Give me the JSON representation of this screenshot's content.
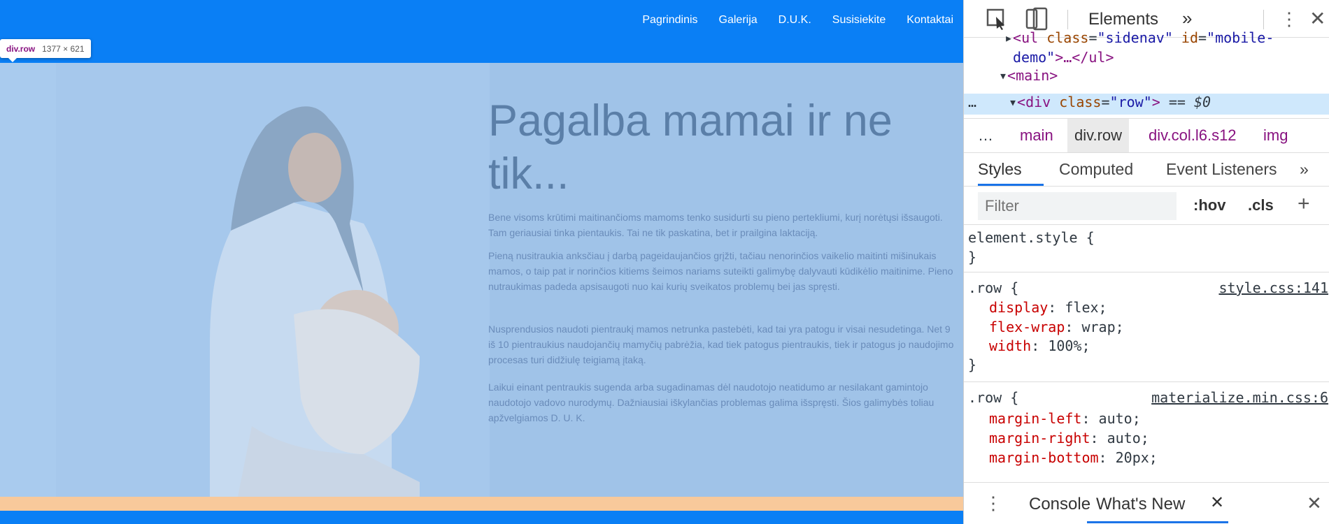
{
  "site": {
    "nav": [
      "Pagrindinis",
      "Galerija",
      "D.U.K.",
      "Susisiekite",
      "Kontaktai"
    ],
    "hero_title": "Pagalba mamai ir ne\ntik...",
    "paragraphs": [
      "Bene visoms krūtimi maitinančioms mamoms tenko susidurti su pieno pertekliumi, kurį norėtųsi išsaugoti. Tam geriausiai tinka pientaukis. Tai ne tik paskatina, bet ir prailgina laktaciją.",
      "Pieną nusitraukia anksčiau į darbą pageidaujančios grįžti, tačiau nenorinčios vaikelio maitinti mišinukais mamos, o taip pat ir norinčios kitiems šeimos nariams suteikti galimybę dalyvauti kūdikėlio maitinime. Pieno nutraukimas padeda apsisaugoti nuo kai kurių sveikatos problemų bei jas spręsti.",
      "Nusprendusios naudoti pientraukį mamos netrunka pastebėti, kad tai yra patogu ir visai nesudetinga. Net 9 iš 10 pientraukius naudojančių mamyčių pabrėžia, kad tiek patogus pientraukis, tiek ir patogus jo naudojimo procesas turi didžiulę teigiamą įtaką.",
      "Laikui einant pentraukis sugenda arba sugadinamas dėl naudotojo neatidumo ar nesilakant gamintojo naudotojo vadovo nurodymų. Dažniausiai iškylančias problemas galima išspręsti. Šios galimybės toliau apžvelgiamos D. U. K."
    ]
  },
  "inspect_tooltip": {
    "tag": "div.row",
    "size": "1377 × 621"
  },
  "devtools": {
    "main_tab": "Elements",
    "more_tabs": "»",
    "dom": {
      "line1_tag_open": "<ul",
      "line1_attr1": "class",
      "line1_val1": "\"sidenav\"",
      "line1_attr2": "id",
      "line1_val2": "\"mobile-",
      "line2_val": "demo\"",
      "line2_rest": ">…</ul>",
      "line3": "<main>",
      "line4_tag": "<div",
      "line4_attr": "class",
      "line4_val": "\"row\"",
      "line4_close": ">",
      "line4_marker": "== $0",
      "dots": "…"
    },
    "breadcrumbs": {
      "ellipsis": "…",
      "items": [
        "main",
        "div.row",
        "div.col.l6.s12",
        "img"
      ]
    },
    "sub_tabs": [
      "Styles",
      "Computed",
      "Event Listeners"
    ],
    "sub_more": "»",
    "filter_placeholder": "Filter",
    "hov": ":hov",
    "cls": ".cls",
    "add": "+",
    "element_style": "element.style {",
    "close_brace": "}",
    "rule1": {
      "selector": ".row {",
      "source": "style.css:141",
      "props": [
        {
          "name": "display",
          "value": "flex;"
        },
        {
          "name": "flex-wrap",
          "value": "wrap;"
        },
        {
          "name": "width",
          "value": "100%;"
        }
      ]
    },
    "rule2": {
      "selector": ".row {",
      "source": "materialize.min.css:6",
      "props": [
        {
          "name": "margin-left",
          "value": "auto;"
        },
        {
          "name": "margin-right",
          "value": "auto;"
        },
        {
          "name": "margin-bottom",
          "value": "20px;"
        }
      ]
    },
    "drawer": {
      "console": "Console",
      "whats_new": "What's New",
      "close_tab": "✕",
      "close": "✕",
      "menu": "⋮"
    }
  },
  "colors": {
    "nav_blue": "#0a7ff5",
    "highlight_overlay": "#a0c3e8",
    "margin_overlay": "#f8c99b",
    "annotation_red": "#e8141c",
    "devtools_selection": "#cfe8fc"
  }
}
